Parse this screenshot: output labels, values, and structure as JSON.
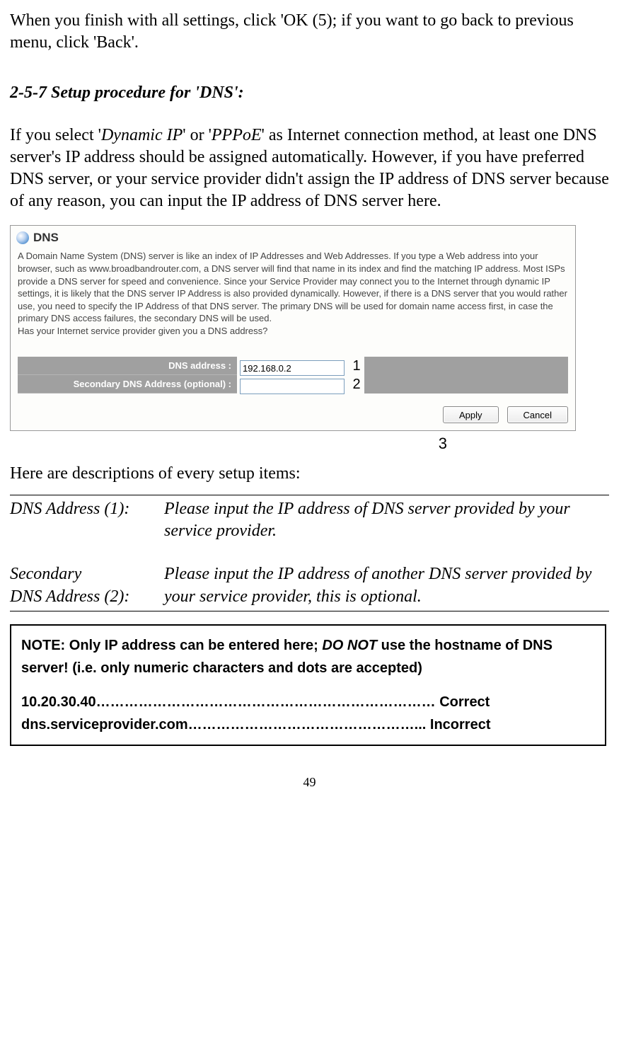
{
  "intro_para": "When you finish with all settings, click 'OK (5); if you want to go back to previous menu, click 'Back'.",
  "heading": "2-5-7 Setup procedure for 'DNS':",
  "body_para_pre": "If you select '",
  "body_para_em1": "Dynamic IP",
  "body_para_mid1": "' or '",
  "body_para_em2": "PPPoE",
  "body_para_post": "' as Internet connection method, at least one DNS server's IP address should be assigned automatically. However, if you have preferred DNS server, or your service provider didn't assign the IP address of DNS server because of any reason, you can input the IP address of DNS server here.",
  "screenshot": {
    "title": "DNS",
    "description": "A Domain Name System (DNS) server is like an index of IP Addresses and Web Addresses. If you type a Web address into your browser, such as www.broadbandrouter.com, a DNS server will find that name in its index and find the matching IP address. Most ISPs provide a DNS server for speed and convenience. Since your Service Provider may connect you to the Internet through dynamic IP settings, it is likely that the DNS server IP Address is also provided dynamically. However, if there is a DNS server that you would rather use, you need to specify the IP Address of that DNS server. The primary DNS will be used for domain name access first, in case the primary DNS access failures, the secondary DNS will be used.\nHas your Internet service provider given you a DNS address?",
    "label1": "DNS address :",
    "value1": "192.168.0.2",
    "label2": "Secondary DNS Address (optional) :",
    "value2": "",
    "btn_apply": "Apply",
    "btn_cancel": "Cancel",
    "ann1": "1",
    "ann2": "2",
    "ann3": "3"
  },
  "desc_heading": "Here are descriptions of every setup items:",
  "defs": {
    "row1_label": "DNS Address (1):",
    "row1_text": "Please input the IP address of DNS server provided by your service provider.",
    "row2_label_a": "Secondary",
    "row2_label_b": "DNS Address (2):",
    "row2_text": "Please input the IP address of another DNS server provided by your service provider, this is optional."
  },
  "note": {
    "l1a": "NOTE: Only IP address can be entered here; ",
    "l1b": "DO NOT",
    "l1c": " use the hostname of DNS server! (i.e. only numeric characters and dots are accepted)",
    "l2": "10.20.30.40……………………………………………………………… Correct",
    "l3": "dns.serviceprovider.com…………………………………………... Incorrect"
  },
  "pagenum": "49"
}
